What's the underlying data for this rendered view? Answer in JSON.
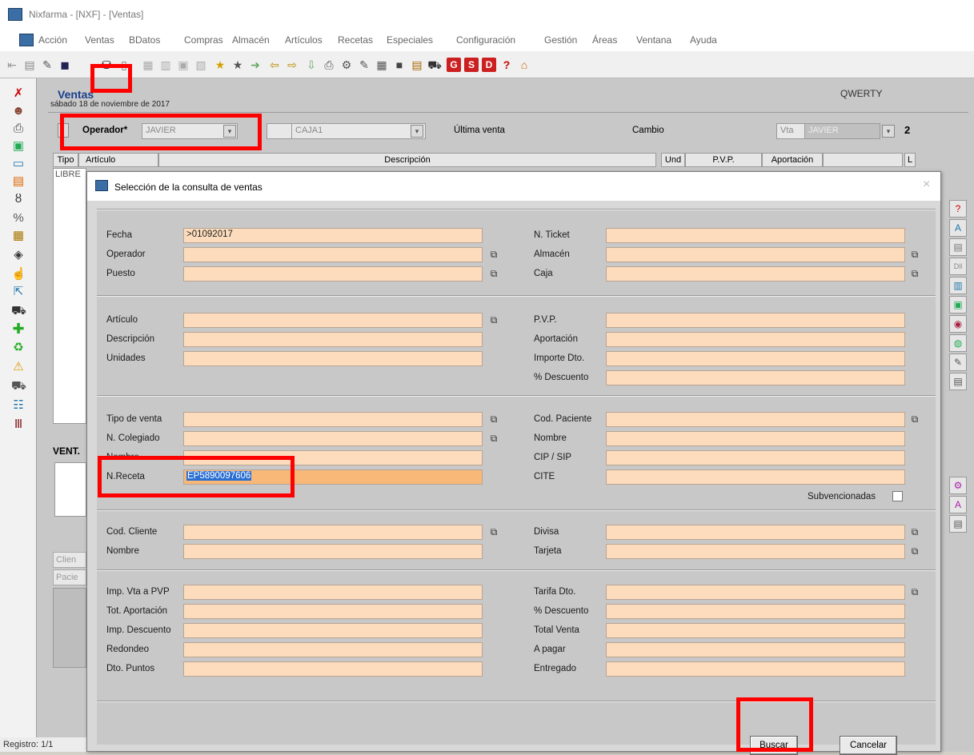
{
  "window": {
    "title": "Nixfarma - [NXF] - [Ventas]"
  },
  "menu": [
    "Acción",
    "Ventas",
    "BDatos",
    "Compras",
    "Almacén",
    "Artículos",
    "Recetas",
    "Especiales",
    "Configuración",
    "Gestión",
    "Áreas",
    "Ventana",
    "Ayuda"
  ],
  "toolbar": {
    "icons": [
      "exit-icon",
      "new-icon",
      "save-icon",
      "print-icon",
      "search-icon",
      "query-icon",
      "cut-icon",
      "copy-icon",
      "paste-icon",
      "undo-icon",
      "favorite-icon",
      "star-icon",
      "enter-icon",
      "left-arrow-icon",
      "right-arrow-icon",
      "import-icon",
      "printer-icon",
      "settings-icon",
      "help-pointer-icon",
      "calculator-icon",
      "list-icon",
      "report-icon",
      "cart-icon"
    ],
    "letter_buttons": [
      "G",
      "S",
      "D"
    ],
    "help": "?"
  },
  "form": {
    "title": "Ventas",
    "date": "sábado 18 de noviembre de 2017",
    "user": "QWERTY",
    "operador_label": "Operador*",
    "operador_value": "JAVIER",
    "caja_value": "CAJA1",
    "ultima_venta_label": "Última venta",
    "cambio_label": "Cambio",
    "vta_label": "Vta",
    "vta_value": "JAVIER",
    "vta_count": "2",
    "table_headers": [
      "Tipo",
      "Artículo",
      "Descripción",
      "Und",
      "P.V.P.",
      "Aportación",
      "L"
    ],
    "first_row_tipo": "LIBRE",
    "ventas_label": "VENT.",
    "cliente_label": "Clien",
    "paciente_label": "Pacie",
    "status": "Registro: 1/1"
  },
  "dialog": {
    "title": "Selección de la consulta de ventas",
    "close": "×",
    "left_fields": [
      {
        "label": "Fecha",
        "value": ">01092017"
      },
      {
        "label": "Operador",
        "value": ""
      },
      {
        "label": "Puesto",
        "value": ""
      },
      {
        "label": "Artículo",
        "value": ""
      },
      {
        "label": "Descripción",
        "value": ""
      },
      {
        "label": "Unidades",
        "value": ""
      },
      {
        "label": "Tipo de venta",
        "value": ""
      },
      {
        "label": "N. Colegiado",
        "value": ""
      },
      {
        "label": "Nombre",
        "value": ""
      },
      {
        "label": "N.Receta",
        "value": "EP5890097606"
      },
      {
        "label": "Cod. Cliente",
        "value": ""
      },
      {
        "label": "Nombre",
        "value": ""
      },
      {
        "label": "Imp. Vta a PVP",
        "value": ""
      },
      {
        "label": "Tot. Aportación",
        "value": ""
      },
      {
        "label": "Imp. Descuento",
        "value": ""
      },
      {
        "label": "Redondeo",
        "value": ""
      },
      {
        "label": "Dto. Puntos",
        "value": ""
      }
    ],
    "right_fields": [
      {
        "label": "N. Ticket",
        "value": ""
      },
      {
        "label": "Almacén",
        "value": ""
      },
      {
        "label": "Caja",
        "value": ""
      },
      {
        "label": "P.V.P.",
        "value": ""
      },
      {
        "label": "Aportación",
        "value": ""
      },
      {
        "label": "Importe Dto.",
        "value": ""
      },
      {
        "label": "% Descuento",
        "value": ""
      },
      {
        "label": "Cod. Paciente",
        "value": ""
      },
      {
        "label": "Nombre",
        "value": ""
      },
      {
        "label": "CIP / SIP",
        "value": ""
      },
      {
        "label": "CITE",
        "value": ""
      },
      {
        "label": "Divisa",
        "value": ""
      },
      {
        "label": "Tarjeta",
        "value": ""
      },
      {
        "label": "Tarifa Dto.",
        "value": ""
      },
      {
        "label": "% Descuento",
        "value": ""
      },
      {
        "label": "Total Venta",
        "value": ""
      },
      {
        "label": "A pagar",
        "value": ""
      },
      {
        "label": "Entregado",
        "value": ""
      }
    ],
    "subvencionadas_label": "Subvencionadas",
    "buscar": "Buscar",
    "cancelar": "Cancelar"
  },
  "colors": {
    "input_bg": "#fcdcbc",
    "selected": "#2b6fd2",
    "highlight": "#ff0000",
    "title_blue": "#1a3e8c"
  }
}
